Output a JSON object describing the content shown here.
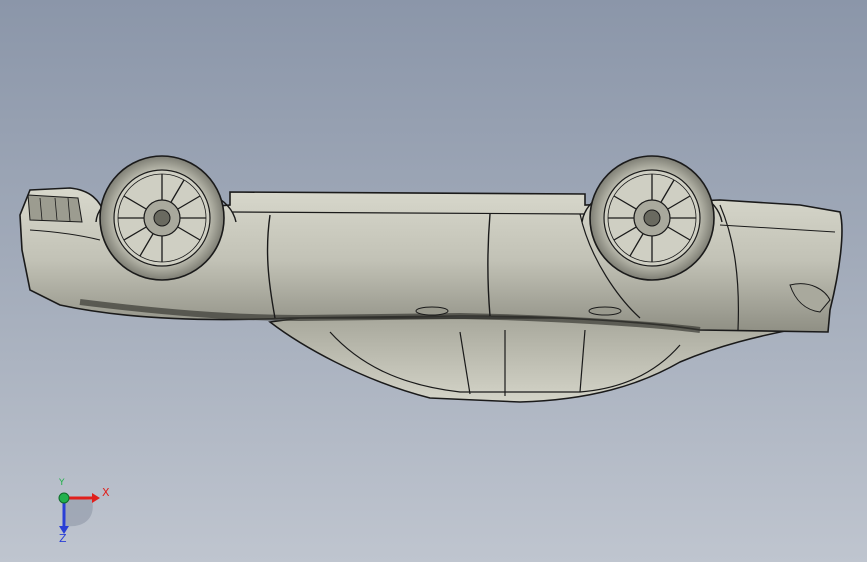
{
  "viewport": {
    "background_top": "#8b96a9",
    "background_bottom": "#bfc5cf"
  },
  "model": {
    "body_color": "#c4c4b8",
    "edge_color": "#1a1a1a",
    "wheel_count": 2
  },
  "triad": {
    "x_label": "X",
    "y_label": "Y",
    "z_label": "Z",
    "x_color": "#e0201c",
    "y_color": "#22b14c",
    "z_color": "#2a3fd6"
  }
}
